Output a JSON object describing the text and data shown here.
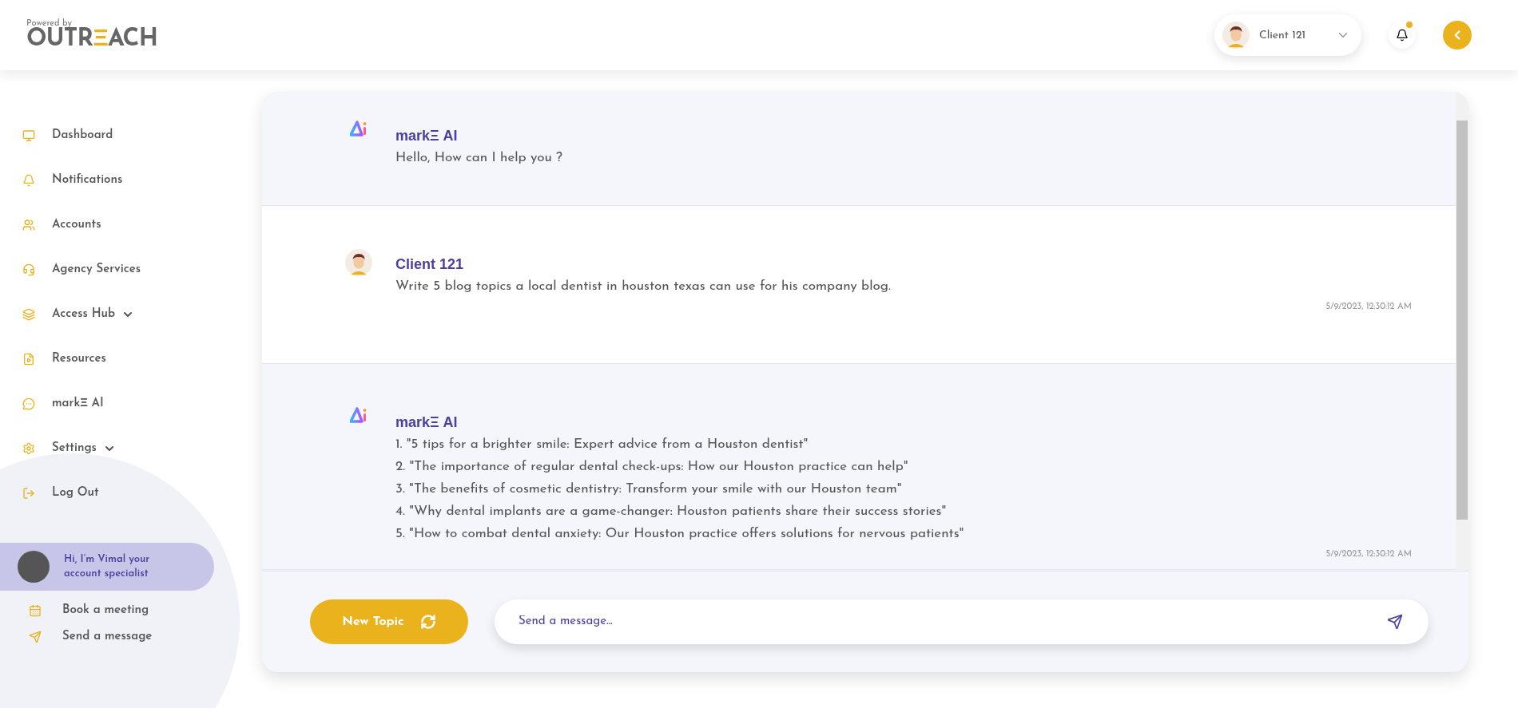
{
  "brand": {
    "tagline": "Powered by",
    "logo": "OUTR",
    "logo_mark": "Ξ",
    "logo_rest": "ACH"
  },
  "header": {
    "user": "Client 121",
    "notification_unread": true
  },
  "sidebar": {
    "items": [
      {
        "label": "Dashboard",
        "submenu": false
      },
      {
        "label": "Notifications",
        "submenu": false
      },
      {
        "label": "Accounts",
        "submenu": false
      },
      {
        "label": "Agency Services",
        "submenu": false
      },
      {
        "label": "Access Hub",
        "submenu": true
      },
      {
        "label": "Resources",
        "submenu": false
      },
      {
        "label": "markΞ AI",
        "submenu": false
      },
      {
        "label": "Settings",
        "submenu": true
      },
      {
        "label": "Log Out",
        "submenu": false
      }
    ],
    "specialist": {
      "text": "Hi, I’m Vimal your account specialist"
    },
    "actions": [
      "Book a meeting",
      "Send a message"
    ]
  },
  "chat": {
    "messages": [
      {
        "kind": "ai",
        "author": "markΞ AI",
        "lines": [
          "Hello, How can I help you ?"
        ]
      },
      {
        "kind": "user",
        "author": "Client 121",
        "lines": [
          "Write 5 blog topics a local dentist in houston texas can use for his company blog."
        ],
        "time": "5/9/2023, 12:30:12 AM"
      },
      {
        "kind": "ai",
        "author": "markΞ AI",
        "lines": [
          "1. \"5 tips for a brighter smile: Expert advice from a Houston dentist\"",
          "2. \"The importance of regular dental check-ups: How our Houston practice can help\"",
          "3. \"The benefits of cosmetic dentistry: Transform your smile with our Houston team\"",
          "4. \"Why dental implants are a game-changer: Houston patients share their success stories\"",
          "5. \"How to combat dental anxiety: Our Houston practice offers solutions for nervous patients\""
        ],
        "time": "5/9/2023, 12:30:12 AM"
      }
    ],
    "new_topic": "New Topic",
    "input_placeholder": "Send a message..."
  }
}
